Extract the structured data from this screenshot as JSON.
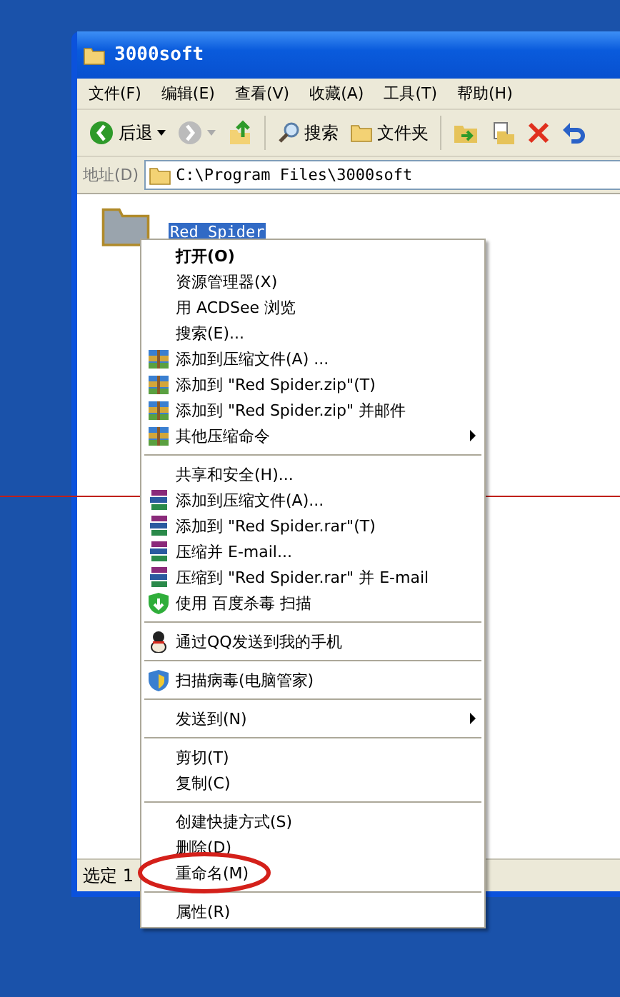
{
  "window": {
    "title": "3000soft",
    "menu": [
      "文件(F)",
      "编辑(E)",
      "查看(V)",
      "收藏(A)",
      "工具(T)",
      "帮助(H)"
    ],
    "toolbar": [
      {
        "kind": "back",
        "label": "后退"
      },
      {
        "kind": "forward",
        "disabled": true
      },
      {
        "kind": "up"
      },
      {
        "kind": "separator"
      },
      {
        "kind": "search",
        "label": "搜索"
      },
      {
        "kind": "folders",
        "label": "文件夹"
      },
      {
        "kind": "separator"
      },
      {
        "kind": "move"
      },
      {
        "kind": "copy"
      },
      {
        "kind": "delete"
      },
      {
        "kind": "undo"
      }
    ],
    "address": {
      "label": "地址(D)",
      "path": "C:\\Program Files\\3000soft"
    },
    "files": [
      {
        "name": "Red Spider",
        "selected": true
      }
    ],
    "status": "选定 1"
  },
  "context_menu": [
    {
      "kind": "plain",
      "label": "打开(O)",
      "bold": true
    },
    {
      "kind": "plain",
      "label": "资源管理器(X)"
    },
    {
      "kind": "plain",
      "label": "用 ACDSee 浏览"
    },
    {
      "kind": "plain",
      "label": "搜索(E)..."
    },
    {
      "kind": "zip",
      "label": "添加到压缩文件(A) ..."
    },
    {
      "kind": "zip",
      "label": "添加到 \"Red Spider.zip\"(T)"
    },
    {
      "kind": "zip",
      "label": "添加到 \"Red Spider.zip\" 并邮件"
    },
    {
      "kind": "zip",
      "label": "其他压缩命令",
      "submenu": true
    },
    {
      "kind": "separator"
    },
    {
      "kind": "plain",
      "label": "共享和安全(H)..."
    },
    {
      "kind": "rar",
      "label": "添加到压缩文件(A)..."
    },
    {
      "kind": "rar",
      "label": "添加到 \"Red Spider.rar\"(T)"
    },
    {
      "kind": "rar",
      "label": "压缩并 E-mail..."
    },
    {
      "kind": "rar",
      "label": "压缩到 \"Red Spider.rar\" 并 E-mail"
    },
    {
      "kind": "green-shield",
      "label": "使用 百度杀毒 扫描"
    },
    {
      "kind": "separator"
    },
    {
      "kind": "figure",
      "label": "通过QQ发送到我的手机"
    },
    {
      "kind": "separator"
    },
    {
      "kind": "blue-shield",
      "label": "扫描病毒(电脑管家)"
    },
    {
      "kind": "separator"
    },
    {
      "kind": "plain",
      "label": "发送到(N)",
      "submenu": true
    },
    {
      "kind": "separator"
    },
    {
      "kind": "plain",
      "label": "剪切(T)"
    },
    {
      "kind": "plain",
      "label": "复制(C)"
    },
    {
      "kind": "separator"
    },
    {
      "kind": "plain",
      "label": "创建快捷方式(S)"
    },
    {
      "kind": "plain",
      "label": "删除(D)"
    },
    {
      "kind": "plain",
      "label": "重命名(M)",
      "circled": true
    },
    {
      "kind": "separator"
    },
    {
      "kind": "plain",
      "label": "属性(R)"
    }
  ],
  "guide_line": true
}
